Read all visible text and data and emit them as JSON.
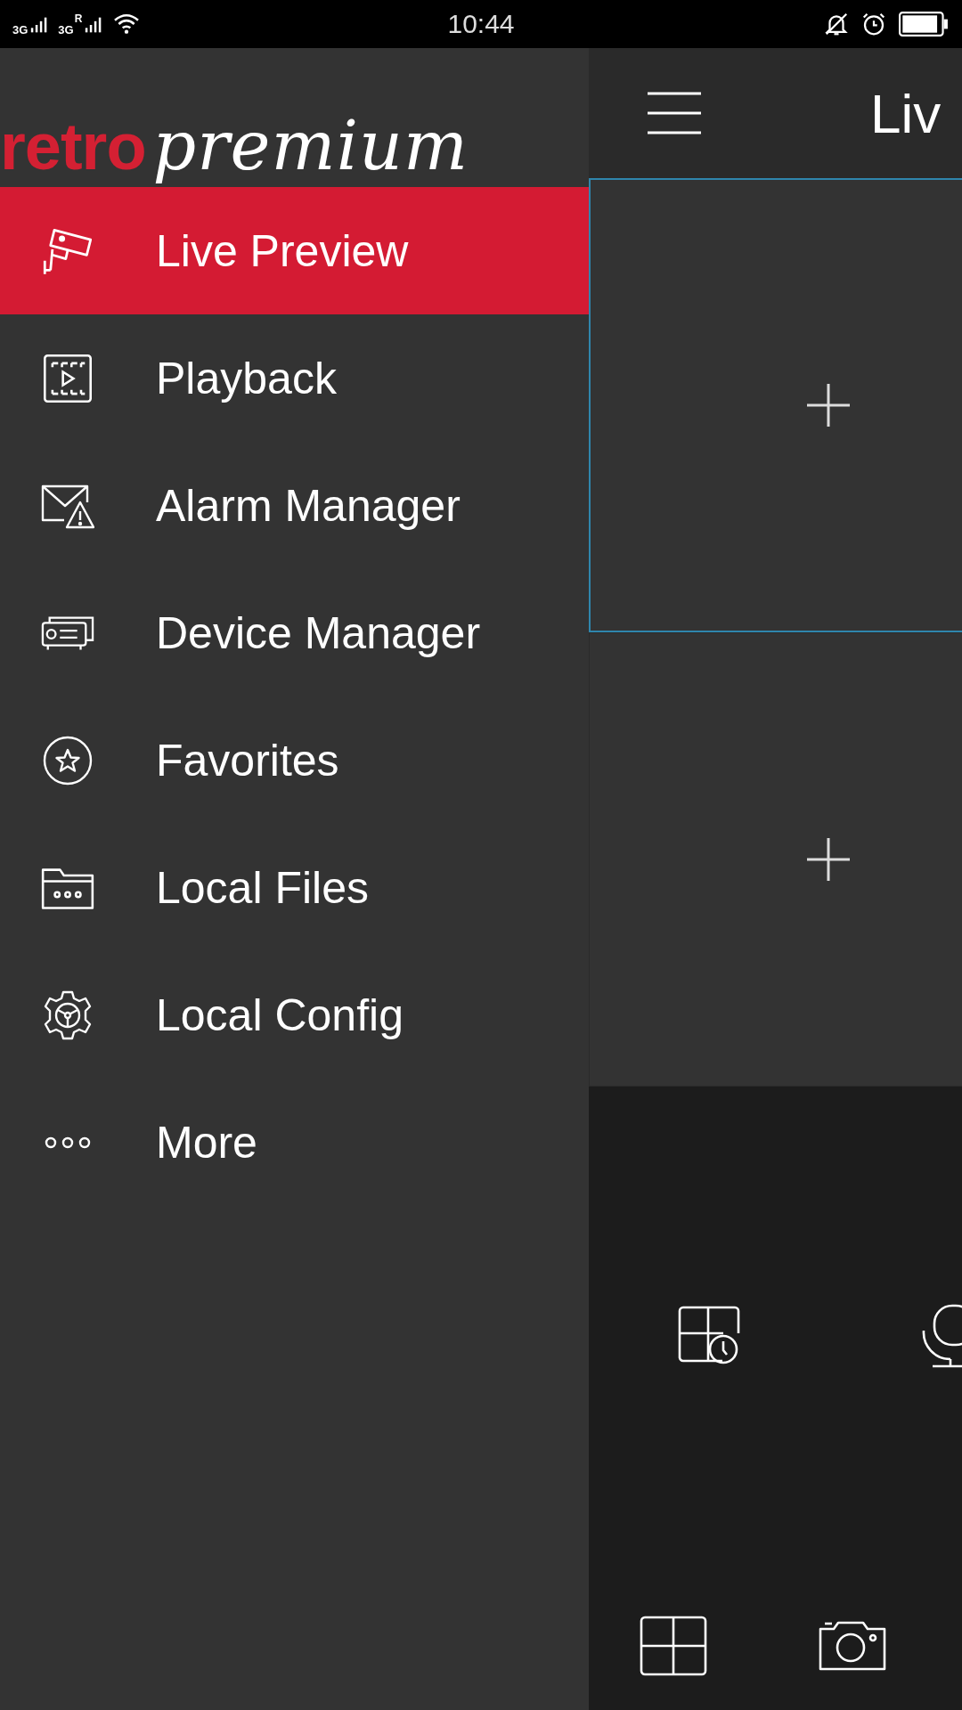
{
  "status_bar": {
    "signal_1": "3G",
    "signal_2": "3G",
    "roaming": "R",
    "time": "10:44"
  },
  "drawer": {
    "logo": {
      "part_1": "retro",
      "part_2": "premium"
    },
    "items": [
      {
        "label": "Live Preview",
        "kind": "camera",
        "selected": true
      },
      {
        "label": "Playback",
        "kind": "film",
        "selected": false
      },
      {
        "label": "Alarm Manager",
        "kind": "alarm",
        "selected": false
      },
      {
        "label": "Device Manager",
        "kind": "device",
        "selected": false
      },
      {
        "label": "Favorites",
        "kind": "star",
        "selected": false
      },
      {
        "label": "Local Files",
        "kind": "folder",
        "selected": false
      },
      {
        "label": "Local Config",
        "kind": "gear",
        "selected": false
      },
      {
        "label": "More",
        "kind": "more",
        "selected": false
      }
    ]
  },
  "main": {
    "title": "Liv",
    "tiles": [
      {
        "selected": true
      },
      {
        "selected": false
      }
    ]
  }
}
